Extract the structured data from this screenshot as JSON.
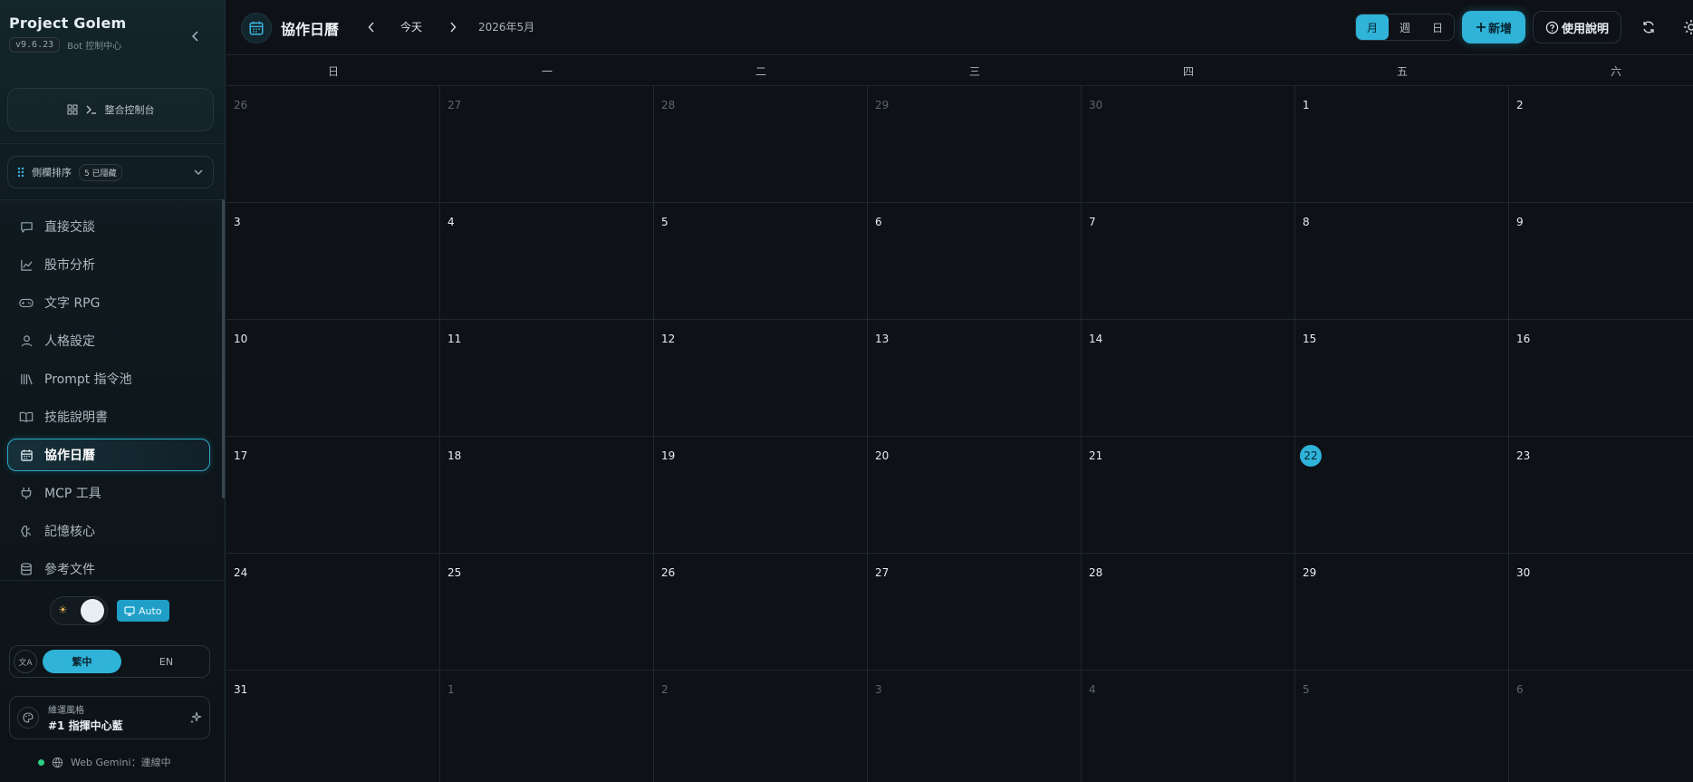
{
  "app": {
    "title": "Project Golem",
    "version": "v9.6.23",
    "subtitle": "Bot 控制中心"
  },
  "sidebar": {
    "console_label": "整合控制台",
    "order_label": "側欄排序",
    "hidden_badge": "5 已隱藏",
    "items": [
      {
        "label": "直接交談",
        "icon": "chat-icon"
      },
      {
        "label": "股市分析",
        "icon": "chart-icon"
      },
      {
        "label": "文字 RPG",
        "icon": "gamepad-icon"
      },
      {
        "label": "人格設定",
        "icon": "user-icon"
      },
      {
        "label": "Prompt 指令池",
        "icon": "library-icon"
      },
      {
        "label": "技能說明書",
        "icon": "book-icon"
      },
      {
        "label": "協作日曆",
        "icon": "calendar-icon",
        "active": true
      },
      {
        "label": "MCP 工具",
        "icon": "plug-icon"
      },
      {
        "label": "記憶核心",
        "icon": "brain-icon"
      },
      {
        "label": "參考文件",
        "icon": "database-icon"
      }
    ],
    "theme_auto_label": "Auto",
    "lang_options": [
      "繁中",
      "EN"
    ],
    "lang_selected": "繁中",
    "style_label": "維運風格",
    "style_value": "#1 指揮中心藍",
    "status_text": "Web Gemini：連線中"
  },
  "calendar": {
    "title": "協作日曆",
    "today_label": "今天",
    "month_label": "2026年5月",
    "views": [
      "月",
      "週",
      "日"
    ],
    "active_view": "月",
    "add_label": "新增",
    "help_label": "使用說明",
    "weekdays": [
      "日",
      "一",
      "二",
      "三",
      "四",
      "五",
      "六"
    ],
    "today_date": "22",
    "weeks": [
      [
        {
          "d": "26",
          "m": true
        },
        {
          "d": "27",
          "m": true
        },
        {
          "d": "28",
          "m": true
        },
        {
          "d": "29",
          "m": true
        },
        {
          "d": "30",
          "m": true
        },
        {
          "d": "1"
        },
        {
          "d": "2"
        }
      ],
      [
        {
          "d": "3"
        },
        {
          "d": "4"
        },
        {
          "d": "5"
        },
        {
          "d": "6"
        },
        {
          "d": "7"
        },
        {
          "d": "8"
        },
        {
          "d": "9"
        }
      ],
      [
        {
          "d": "10"
        },
        {
          "d": "11"
        },
        {
          "d": "12"
        },
        {
          "d": "13"
        },
        {
          "d": "14"
        },
        {
          "d": "15"
        },
        {
          "d": "16"
        }
      ],
      [
        {
          "d": "17"
        },
        {
          "d": "18"
        },
        {
          "d": "19"
        },
        {
          "d": "20"
        },
        {
          "d": "21"
        },
        {
          "d": "22",
          "today": true
        },
        {
          "d": "23"
        }
      ],
      [
        {
          "d": "24"
        },
        {
          "d": "25"
        },
        {
          "d": "26"
        },
        {
          "d": "27"
        },
        {
          "d": "28"
        },
        {
          "d": "29"
        },
        {
          "d": "30"
        }
      ],
      [
        {
          "d": "31"
        },
        {
          "d": "1",
          "m": true
        },
        {
          "d": "2",
          "m": true
        },
        {
          "d": "3",
          "m": true
        },
        {
          "d": "4",
          "m": true
        },
        {
          "d": "5",
          "m": true
        },
        {
          "d": "6",
          "m": true
        }
      ]
    ]
  },
  "colors": {
    "accent": "#2fb3d8",
    "status_online": "#2ecf87",
    "background": "#0e1116"
  }
}
